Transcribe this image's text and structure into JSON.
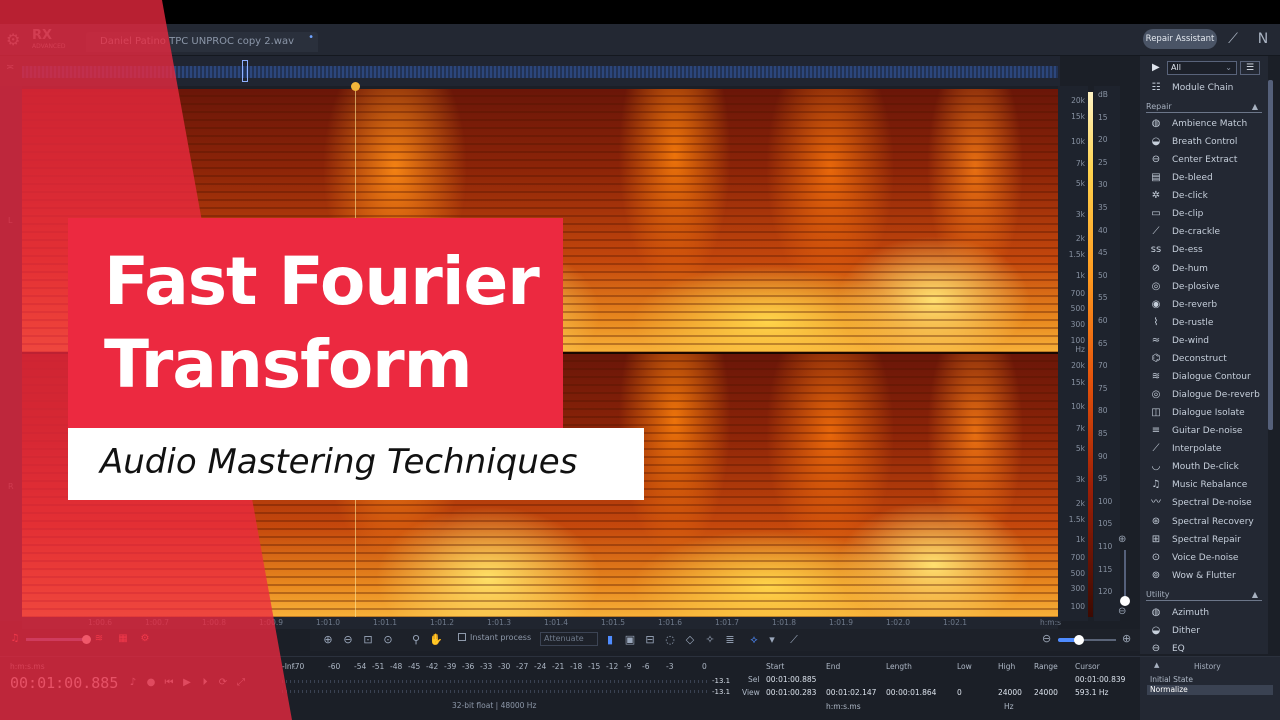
{
  "app": {
    "logo_text": "RX",
    "logo_sub": "ADVANCED",
    "file_tab": "Daniel Patino TPC UNPROC copy 2.wav",
    "repair_assistant": "Repair Assistant"
  },
  "overlay": {
    "title_line1": "Fast Fourier",
    "title_line2": "Transform",
    "subtitle": "Audio Mastering Techniques"
  },
  "panel": {
    "filter_value": "All",
    "module_chain": "Module Chain",
    "repair_section": "Repair",
    "utility_section": "Utility",
    "repair_modules": [
      {
        "label": "Ambience Match",
        "icon": "ambience-match-icon"
      },
      {
        "label": "Breath Control",
        "icon": "breath-control-icon"
      },
      {
        "label": "Center Extract",
        "icon": "center-extract-icon"
      },
      {
        "label": "De-bleed",
        "icon": "de-bleed-icon"
      },
      {
        "label": "De-click",
        "icon": "de-click-icon"
      },
      {
        "label": "De-clip",
        "icon": "de-clip-icon"
      },
      {
        "label": "De-crackle",
        "icon": "de-crackle-icon"
      },
      {
        "label": "De-ess",
        "icon": "de-ess-icon"
      },
      {
        "label": "De-hum",
        "icon": "de-hum-icon"
      },
      {
        "label": "De-plosive",
        "icon": "de-plosive-icon"
      },
      {
        "label": "De-reverb",
        "icon": "de-reverb-icon"
      },
      {
        "label": "De-rustle",
        "icon": "de-rustle-icon"
      },
      {
        "label": "De-wind",
        "icon": "de-wind-icon"
      },
      {
        "label": "Deconstruct",
        "icon": "deconstruct-icon"
      },
      {
        "label": "Dialogue Contour",
        "icon": "dialogue-contour-icon"
      },
      {
        "label": "Dialogue De-reverb",
        "icon": "dialogue-de-reverb-icon"
      },
      {
        "label": "Dialogue Isolate",
        "icon": "dialogue-isolate-icon"
      },
      {
        "label": "Guitar De-noise",
        "icon": "guitar-de-noise-icon"
      },
      {
        "label": "Interpolate",
        "icon": "interpolate-icon"
      },
      {
        "label": "Mouth De-click",
        "icon": "mouth-de-click-icon"
      },
      {
        "label": "Music Rebalance",
        "icon": "music-rebalance-icon"
      },
      {
        "label": "Spectral De-noise",
        "icon": "spectral-de-noise-icon"
      },
      {
        "label": "Spectral Recovery",
        "icon": "spectral-recovery-icon"
      },
      {
        "label": "Spectral Repair",
        "icon": "spectral-repair-icon"
      },
      {
        "label": "Voice De-noise",
        "icon": "voice-de-noise-icon"
      },
      {
        "label": "Wow & Flutter",
        "icon": "wow-flutter-icon"
      }
    ],
    "utility_modules": [
      {
        "label": "Azimuth",
        "icon": "azimuth-icon"
      },
      {
        "label": "Dither",
        "icon": "dither-icon"
      },
      {
        "label": "EQ",
        "icon": "eq-icon"
      }
    ]
  },
  "hz_scale": {
    "top": [
      "20k",
      "15k",
      "10k",
      "7k",
      "5k",
      "3k",
      "2k",
      "1.5k",
      "1k",
      "700",
      "500",
      "300",
      "100",
      "Hz"
    ],
    "bottom": [
      "20k",
      "15k",
      "10k",
      "7k",
      "5k",
      "3k",
      "2k",
      "1.5k",
      "1k",
      "700",
      "500",
      "300",
      "100"
    ]
  },
  "db_scale": [
    "dB",
    "15",
    "20",
    "25",
    "30",
    "35",
    "40",
    "45",
    "50",
    "55",
    "60",
    "65",
    "70",
    "75",
    "80",
    "85",
    "90",
    "95",
    "100",
    "105",
    "110",
    "115",
    "120"
  ],
  "time_ruler": [
    "1:00.6",
    "1:00.7",
    "1:00.8",
    "1:00.9",
    "1:01.0",
    "1:01.1",
    "1:01.2",
    "1:01.3",
    "1:01.4",
    "1:01.5",
    "1:01.6",
    "1:01.7",
    "1:01.8",
    "1:01.9",
    "1:02.0",
    "1:02.1",
    "h:m:s"
  ],
  "toolbar": {
    "instant_process": "Instant process",
    "attenuate": "Attenuate"
  },
  "transport": {
    "timecode_label": "h:m:s.ms",
    "timecode": "00:01:00.885"
  },
  "meter": {
    "labels": [
      "-Inf.",
      "-70",
      "-60",
      "-54",
      "-51",
      "-48",
      "-45",
      "-42",
      "-39",
      "-36",
      "-33",
      "-30",
      "-27",
      "-24",
      "-21",
      "-18",
      "-15",
      "-12",
      "-9",
      "-6",
      "-3",
      "0"
    ],
    "left_value": "-13.1",
    "right_value": "-13.1",
    "format": "32-bit float | 48000 Hz"
  },
  "selection": {
    "headers": [
      "Start",
      "End",
      "Length",
      "Low",
      "High",
      "Range",
      "Cursor"
    ],
    "sel_label": "Sel",
    "view_label": "View",
    "sel_start": "00:01:00.885",
    "view_start": "00:01:00.283",
    "view_end": "00:01:02.147",
    "view_length": "00:00:01.864",
    "low": "0",
    "high": "24000",
    "range": "24000",
    "cursor_time": "00:01:00.839",
    "cursor_hz": "593.1 Hz",
    "unit_time": "h:m:s.ms",
    "unit_hz": "Hz"
  },
  "history": {
    "title": "History",
    "items": [
      "Initial State",
      "Normalize"
    ]
  },
  "colors": {
    "accent_red": "#ec2940",
    "accent_blue": "#4f8cff",
    "panel_bg": "#232833"
  }
}
